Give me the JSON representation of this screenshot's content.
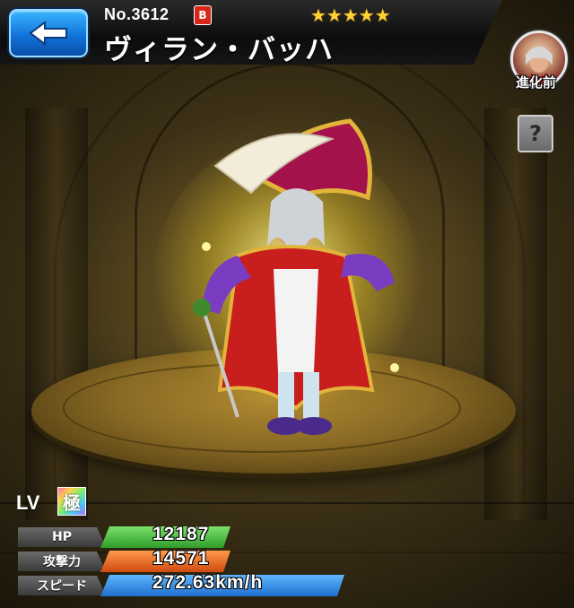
{
  "header": {
    "number_label": "No.3612",
    "rarity_stars": "★★★★★",
    "name": "ヴィラン・バッハ",
    "badge_glyph": "B"
  },
  "side": {
    "evolution_label": "進化前",
    "help_glyph": "?"
  },
  "stats": {
    "lv_label": "LV",
    "lv_badge": "極",
    "hp": {
      "label": "HP",
      "value": "12187",
      "color": "#46c23a"
    },
    "attack": {
      "label": "攻撃力",
      "value": "14571",
      "color": "#e8621c"
    },
    "speed": {
      "label": "スピード",
      "value": "272.63km/h",
      "color": "#2b8fe6"
    }
  },
  "colors": {
    "back_button": "#1273d9",
    "stars": "#ffd23a",
    "platform": "#8a6a24"
  }
}
